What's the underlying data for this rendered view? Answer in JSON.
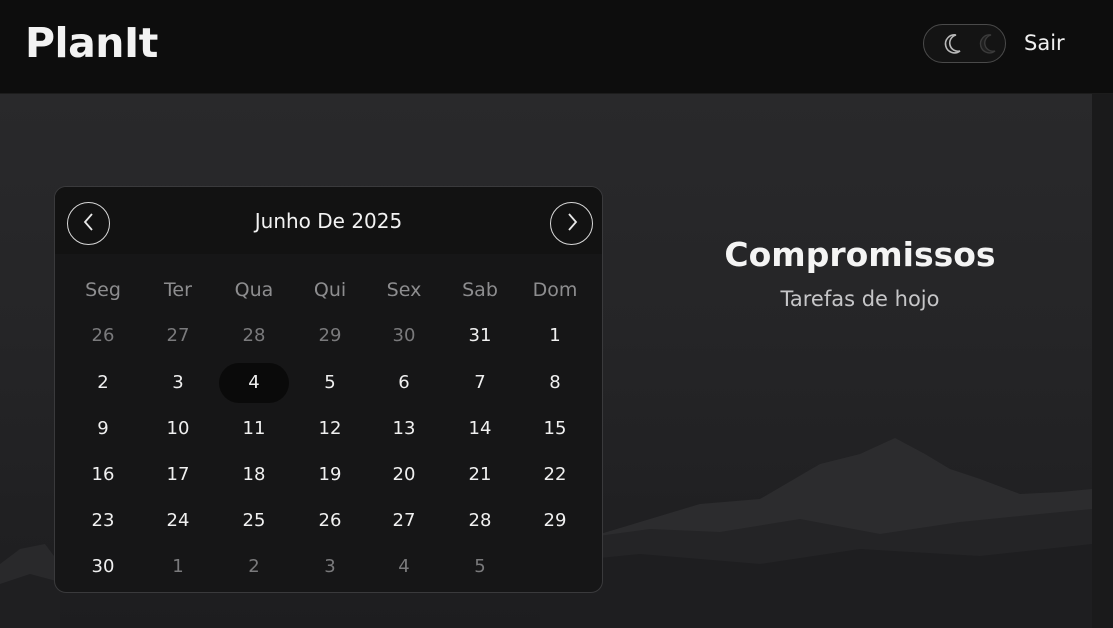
{
  "header": {
    "logo": "PlanIt",
    "theme_toggle_icons": [
      "moon-icon",
      "moon-icon"
    ],
    "logout_label": "Sair"
  },
  "calendar": {
    "title": "Junho De 2025",
    "prev_icon": "chevron-left-icon",
    "next_icon": "chevron-right-icon",
    "weekdays": [
      "Seg",
      "Ter",
      "Qua",
      "Qui",
      "Sex",
      "Sab",
      "Dom"
    ],
    "weeks": [
      [
        {
          "d": "26",
          "m": true
        },
        {
          "d": "27",
          "m": true
        },
        {
          "d": "28",
          "m": true
        },
        {
          "d": "29",
          "m": true
        },
        {
          "d": "30",
          "m": true
        },
        {
          "d": "31",
          "m": false
        },
        {
          "d": "1",
          "m": false
        }
      ],
      [
        {
          "d": "2",
          "m": false
        },
        {
          "d": "3",
          "m": false
        },
        {
          "d": "4",
          "m": false,
          "s": true
        },
        {
          "d": "5",
          "m": false
        },
        {
          "d": "6",
          "m": false
        },
        {
          "d": "7",
          "m": false
        },
        {
          "d": "8",
          "m": false
        }
      ],
      [
        {
          "d": "9",
          "m": false
        },
        {
          "d": "10",
          "m": false
        },
        {
          "d": "11",
          "m": false
        },
        {
          "d": "12",
          "m": false
        },
        {
          "d": "13",
          "m": false
        },
        {
          "d": "14",
          "m": false
        },
        {
          "d": "15",
          "m": false
        }
      ],
      [
        {
          "d": "16",
          "m": false
        },
        {
          "d": "17",
          "m": false
        },
        {
          "d": "18",
          "m": false
        },
        {
          "d": "19",
          "m": false
        },
        {
          "d": "20",
          "m": false
        },
        {
          "d": "21",
          "m": false
        },
        {
          "d": "22",
          "m": false
        }
      ],
      [
        {
          "d": "23",
          "m": false
        },
        {
          "d": "24",
          "m": false
        },
        {
          "d": "25",
          "m": false
        },
        {
          "d": "26",
          "m": false
        },
        {
          "d": "27",
          "m": false
        },
        {
          "d": "28",
          "m": false
        },
        {
          "d": "29",
          "m": false
        }
      ],
      [
        {
          "d": "30",
          "m": false
        },
        {
          "d": "1",
          "m": true
        },
        {
          "d": "2",
          "m": true
        },
        {
          "d": "3",
          "m": true
        },
        {
          "d": "4",
          "m": true
        },
        {
          "d": "5",
          "m": true
        }
      ]
    ]
  },
  "appointments": {
    "title": "Compromissos",
    "subtitle": "Tarefas de hojo"
  },
  "colors": {
    "header_bg": "#0d0d0d",
    "page_bg": "#232325",
    "calendar_bg": "#161617",
    "selected_day_bg": "#0a0a0a"
  }
}
